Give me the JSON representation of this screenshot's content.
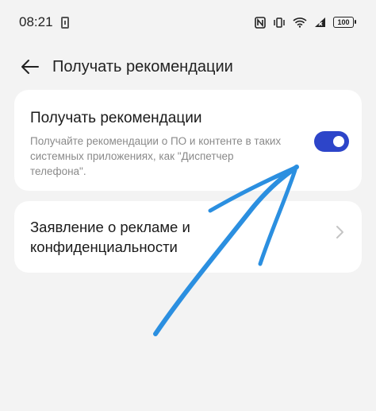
{
  "status_bar": {
    "time": "08:21",
    "battery": "100",
    "icons": [
      "sim-card-icon",
      "nfc-icon",
      "vibrate-icon",
      "wifi-icon",
      "no-signal-icon",
      "battery-icon"
    ]
  },
  "header": {
    "title": "Получать рекомендации",
    "back_icon": "arrow-left-icon"
  },
  "recommendations_card": {
    "title": "Получать рекомендации",
    "description": "Получайте рекомендации о ПО и контенте в таких системных приложениях, как \"Диспетчер телефона\".",
    "toggle_on": true
  },
  "privacy_card": {
    "label": "Заявление о рекламе и конфиденциальности",
    "chevron_icon": "chevron-right-icon"
  },
  "colors": {
    "background": "#f3f3f3",
    "card": "#ffffff",
    "toggle_on": "#2d45c9",
    "annotation_arrow": "#2b8fe0"
  },
  "annotation": {
    "icon": "hand-drawn-arrow-icon"
  }
}
